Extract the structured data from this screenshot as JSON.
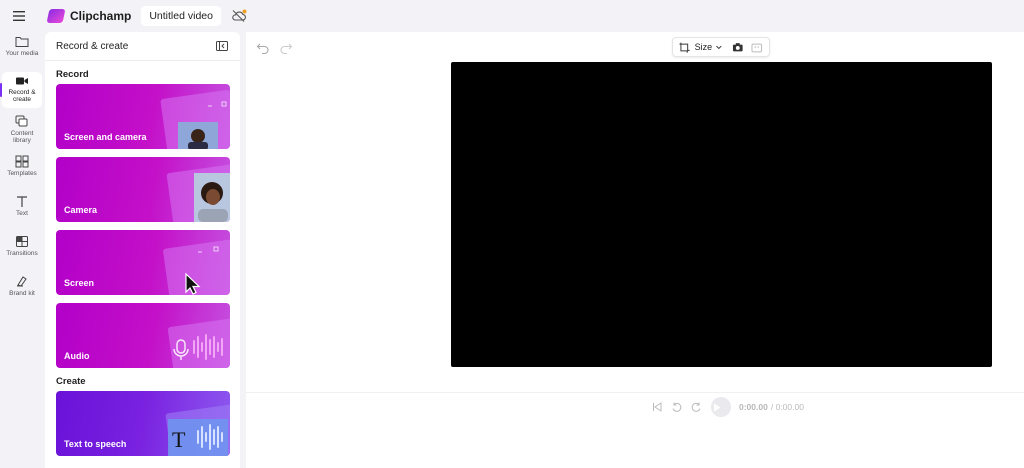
{
  "app": {
    "name": "Clipchamp",
    "project_title": "Untitled video"
  },
  "nav": {
    "items": [
      {
        "label": "Your media"
      },
      {
        "label": "Record &\ncreate"
      },
      {
        "label": "Content\nlibrary"
      },
      {
        "label": "Templates"
      },
      {
        "label": "Text"
      },
      {
        "label": "Transitions"
      },
      {
        "label": "Brand kit"
      }
    ]
  },
  "panel": {
    "title": "Record & create",
    "record_heading": "Record",
    "create_heading": "Create",
    "cards": [
      {
        "label": "Screen and camera"
      },
      {
        "label": "Camera"
      },
      {
        "label": "Screen"
      },
      {
        "label": "Audio"
      },
      {
        "label": "Text to speech"
      }
    ]
  },
  "toolbar": {
    "size_label": "Size"
  },
  "player": {
    "current_time": "0:00.00",
    "total_time": "/ 0:00.00"
  },
  "colors": {
    "accent": "#7b2ff2",
    "card_magenta": "#c410c8",
    "card_violet": "#7a22e0"
  }
}
